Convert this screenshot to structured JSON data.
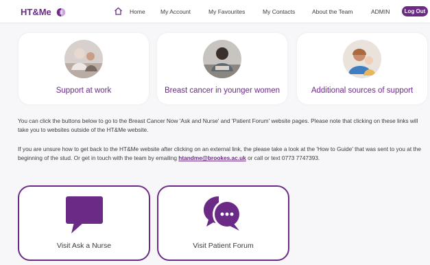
{
  "nav": {
    "logo": "HT&Me",
    "home": "Home",
    "account": "My Account",
    "favourites": "My Favourites",
    "contacts": "My Contacts",
    "team": "About the Team",
    "admin": "ADMIN",
    "logout": "Log Out"
  },
  "cards": [
    {
      "label": "Support at work"
    },
    {
      "label": "Breast cancer in younger women"
    },
    {
      "label": "Additional sources of support"
    }
  ],
  "info": {
    "p1": "You can click the buttons below to go to the Breast Cancer Now 'Ask and Nurse' and 'Patient Forum' website pages. Please note that clicking on these links will take you to websites outside of the HT&Me website.",
    "p2_before": "If you are unsure how to get back to the HT&Me website after clicking on an external link, the please take a look at the 'How to Guide' that was sent to you at the beginning of the stud. Or get in touch with the team by emailing ",
    "email": "htandme@brookes.ac.uk",
    "p2_after": " or call or text 0773 7747393."
  },
  "buttons": {
    "nurse": "Visit Ask a Nurse",
    "forum": "Visit Patient Forum"
  },
  "colors": {
    "brand": "#6b2a86",
    "background": "#f7f6f8"
  },
  "icons": {
    "logo": "ht-me-logo-icon",
    "home": "home-icon",
    "nurse": "speech-bubble-icon",
    "forum": "chat-bubbles-icon"
  }
}
